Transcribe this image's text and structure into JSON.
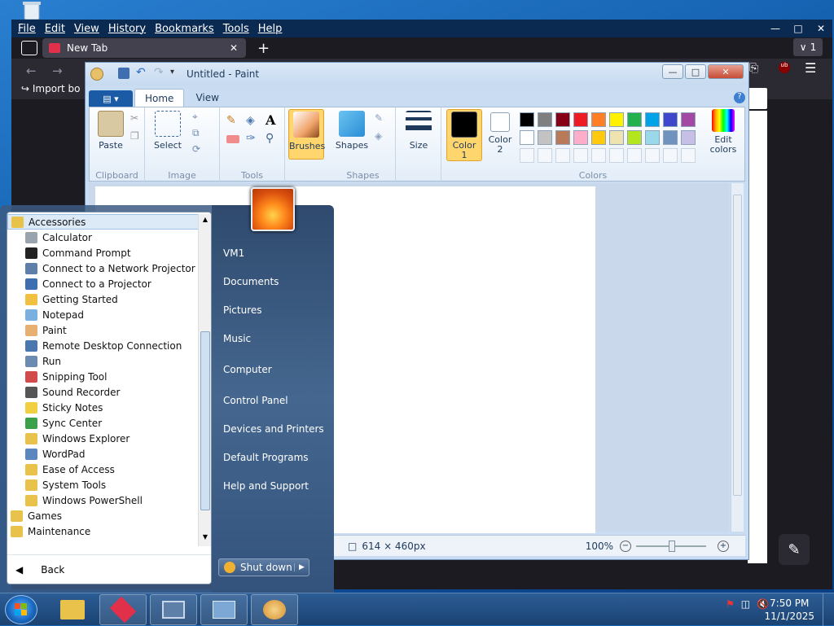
{
  "browser": {
    "menu": [
      "File",
      "Edit",
      "View",
      "History",
      "Bookmarks",
      "Tools",
      "Help"
    ],
    "tab_title": "New Tab",
    "tab_count": "1",
    "bookmark_import": "Import bo"
  },
  "paint": {
    "title": "Untitled - Paint",
    "tabs": [
      "Home",
      "View"
    ],
    "groups": {
      "clipboard": "Clipboard",
      "image": "Image",
      "tools": "Tools",
      "shapes": "Shapes",
      "colors": "Colors"
    },
    "buttons": {
      "paste": "Paste",
      "select": "Select",
      "brushes": "Brushes",
      "shapes": "Shapes",
      "size": "Size",
      "color1": "Color\n1",
      "color2": "Color\n2",
      "edit_colors": "Edit\ncolors"
    },
    "status": {
      "dimensions": "614 × 460px",
      "zoom": "100%"
    },
    "palette_row1": [
      "#000000",
      "#7f7f7f",
      "#880015",
      "#ed1c24",
      "#ff7f27",
      "#fff200",
      "#22b14c",
      "#00a2e8",
      "#3f48cc",
      "#a349a4"
    ],
    "palette_row2": [
      "#ffffff",
      "#c3c3c3",
      "#b97a57",
      "#ffaec9",
      "#ffc90e",
      "#efe4b0",
      "#b5e61d",
      "#99d9ea",
      "#7092be",
      "#c8bfe7"
    ]
  },
  "start_menu": {
    "folder_open": "Accessories",
    "accessories": [
      "Calculator",
      "Command Prompt",
      "Connect to a Network Projector",
      "Connect to a Projector",
      "Getting Started",
      "Notepad",
      "Paint",
      "Remote Desktop Connection",
      "Run",
      "Snipping Tool",
      "Sound Recorder",
      "Sticky Notes",
      "Sync Center",
      "Windows Explorer",
      "WordPad"
    ],
    "subfolders": [
      "Ease of Access",
      "System Tools",
      "Windows PowerShell"
    ],
    "folders": [
      "Games",
      "Maintenance"
    ],
    "back": "Back",
    "right_items": [
      "VM1",
      "Documents",
      "Pictures",
      "Music",
      "Computer",
      "Control Panel",
      "Devices and Printers",
      "Default Programs",
      "Help and Support"
    ],
    "shutdown": "Shut down"
  },
  "taskbar": {
    "time": "7:50 PM",
    "date": "11/1/2025"
  }
}
